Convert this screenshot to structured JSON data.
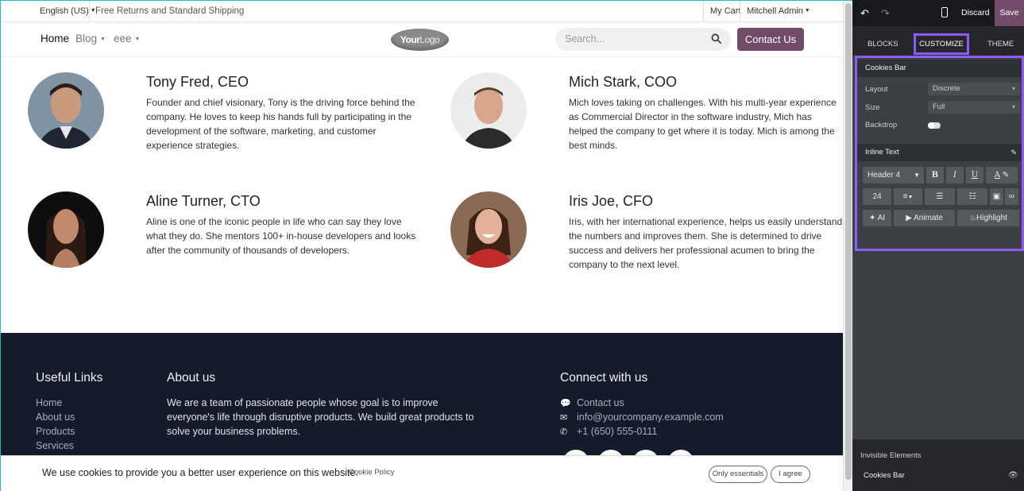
{
  "site": {
    "topbar": {
      "language": "English (US)",
      "shipping": "Free Returns and Standard Shipping",
      "cart": "My Cart",
      "user": "Mitchell Admin"
    },
    "nav": {
      "home": "Home",
      "blog": "Blog",
      "eee": "eee",
      "logo_main": "Your",
      "logo_sub": "Logo",
      "search_placeholder": "Search...",
      "contact": "Contact Us"
    },
    "team": [
      {
        "name": "Tony Fred, CEO",
        "desc": "Founder and chief visionary, Tony is the driving force behind the company. He loves to keep his hands full by participating in the development of the software, marketing, and customer experience strategies."
      },
      {
        "name": "Mich Stark, COO",
        "desc": "Mich loves taking on challenges. With his multi-year experience as Commercial Director in the software industry, Mich has helped the company to get where it is today. Mich is among the best minds."
      },
      {
        "name": "Aline Turner, CTO",
        "desc": "Aline is one of the iconic people in life who can say they love what they do. She mentors 100+ in-house developers and looks after the community of thousands of developers."
      },
      {
        "name": "Iris Joe, CFO",
        "desc": "Iris, with her international experience, helps us easily understand the numbers and improves them. She is determined to drive success and delivers her professional acumen to bring the company to the next level."
      }
    ],
    "footer": {
      "useful_links_title": "Useful Links",
      "links": [
        "Home",
        "About us",
        "Products",
        "Services"
      ],
      "about_title": "About us",
      "about_text": "We are a team of passionate people whose goal is to improve everyone's life through disruptive products. We build great products to solve your business problems.",
      "connect_title": "Connect with us",
      "contact_us": "Contact us",
      "email": "info@yourcompany.example.com",
      "phone": "+1 (650) 555-0111"
    },
    "cookie": {
      "message": "We use cookies to provide you a better user experience on this website.",
      "policy": "Cookie Policy",
      "essentials": "Only essentials",
      "agree": "I agree"
    }
  },
  "panel": {
    "discard": "Discard",
    "save": "Save",
    "tabs": {
      "blocks": "BLOCKS",
      "customize": "CUSTOMIZE",
      "theme": "THEME"
    },
    "cookies_bar": {
      "title": "Cookies Bar",
      "layout_label": "Layout",
      "layout_value": "Discrete",
      "size_label": "Size",
      "size_value": "Full",
      "backdrop_label": "Backdrop"
    },
    "inline_text": {
      "title": "Inline Text",
      "header": "Header 4",
      "font_size": "24",
      "ai": "AI",
      "animate": "Animate",
      "highlight": "Highlight"
    },
    "invisible_title": "Invisible Elements",
    "invisible_item": "Cookies Bar"
  },
  "colors": {
    "brand": "#714b67",
    "footer_bg": "#151b2b",
    "panel_bg": "#3c3f44",
    "highlight_border": "#8b5cf6"
  }
}
